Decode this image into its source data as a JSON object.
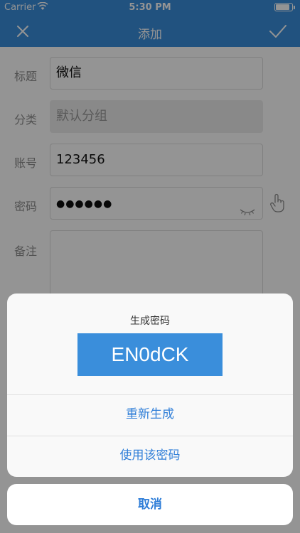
{
  "status_bar": {
    "carrier": "Carrier",
    "time": "5:30 PM",
    "battery_level": 0.9
  },
  "nav": {
    "title": "添加",
    "close_icon": "close-icon",
    "done_icon": "checkmark-icon"
  },
  "form": {
    "title_label": "标题",
    "title_value": "微信",
    "category_label": "分类",
    "category_value": "默认分组",
    "account_label": "账号",
    "account_value": "123456",
    "password_label": "密码",
    "password_value": "●●●●●●",
    "note_label": "备注",
    "note_value": ""
  },
  "sheet": {
    "title": "生成密码",
    "generated_password": "EN0dCK",
    "regenerate_label": "重新生成",
    "use_password_label": "使用该密码",
    "cancel_label": "取消"
  },
  "colors": {
    "accent": "#3a8edb",
    "action_text": "#2f7ed8"
  }
}
